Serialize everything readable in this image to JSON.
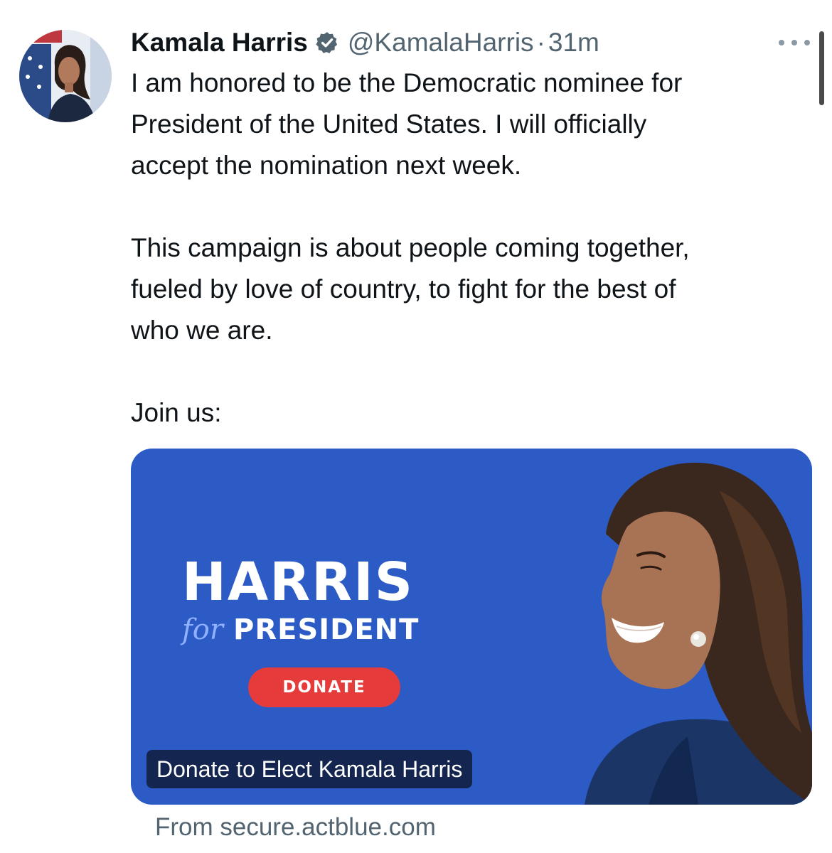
{
  "tweet": {
    "author_name": "Kamala Harris",
    "verified_icon": "verified-badge-icon",
    "handle": "@KamalaHarris",
    "separator": "·",
    "time": "31m",
    "more_icon": "more-options-icon",
    "paragraphs": [
      "I am honored to be the Democratic nominee for\nPresident of the United States. I will officially\naccept the nomination next week.",
      "This campaign is about people coming together,\nfueled by love of country, to fight for the best of\nwho we are.",
      "Join us:"
    ]
  },
  "card": {
    "logo_harris": "HARRIS",
    "logo_for": "for",
    "logo_president": "PRESIDENT",
    "donate_label": "DONATE",
    "title": "Donate to Elect Kamala Harris",
    "source": "From secure.actblue.com",
    "colors": {
      "background": "#2c5bc6",
      "donate": "#e63b3b"
    }
  },
  "colors": {
    "text": "#0f1419",
    "secondary": "#536471",
    "verified": "#536471"
  }
}
